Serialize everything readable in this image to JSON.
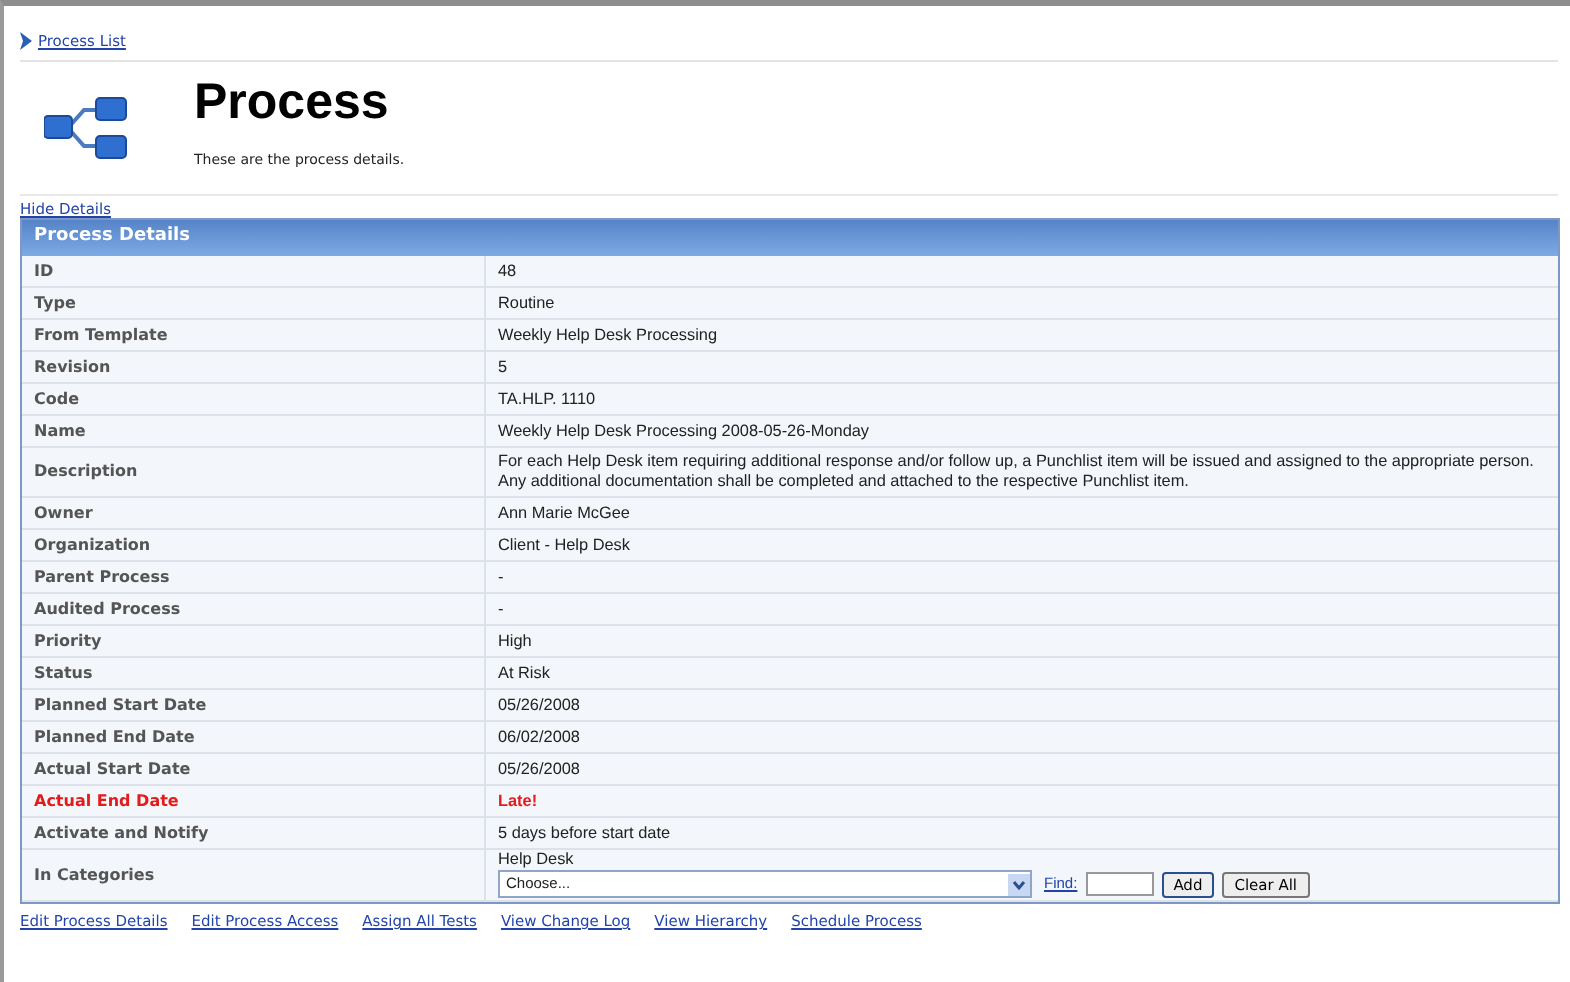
{
  "breadcrumb": {
    "link": "Process List"
  },
  "header": {
    "title": "Process",
    "subtitle": "These are the process details."
  },
  "toggle_link": "Hide Details",
  "panel": {
    "title": "Process Details",
    "rows": [
      {
        "kind": "text",
        "label": "ID",
        "value": "48",
        "alert": false
      },
      {
        "kind": "text",
        "label": "Type",
        "value": "Routine",
        "alert": false
      },
      {
        "kind": "text",
        "label": "From Template",
        "value": "Weekly Help Desk Processing",
        "alert": false
      },
      {
        "kind": "text",
        "label": "Revision",
        "value": "5",
        "alert": false
      },
      {
        "kind": "text",
        "label": "Code",
        "value": "TA.HLP. 1110",
        "alert": false
      },
      {
        "kind": "text",
        "label": "Name",
        "value": "Weekly Help Desk Processing 2008-05-26-Monday",
        "alert": false
      },
      {
        "kind": "text",
        "label": "Description",
        "value": "For each Help Desk item requiring additional response and/or follow up, a Punchlist item will be issued and assigned to the appropriate person.\n Any additional documentation shall be completed and attached to the respective Punchlist item.",
        "alert": false
      },
      {
        "kind": "text",
        "label": "Owner",
        "value": "Ann Marie McGee",
        "alert": false
      },
      {
        "kind": "text",
        "label": "Organization",
        "value": "Client - Help Desk",
        "alert": false
      },
      {
        "kind": "text",
        "label": "Parent Process",
        "value": "-",
        "alert": false
      },
      {
        "kind": "text",
        "label": "Audited Process",
        "value": "-",
        "alert": false
      },
      {
        "kind": "text",
        "label": "Priority",
        "value": "High",
        "alert": false
      },
      {
        "kind": "text",
        "label": "Status",
        "value": "At Risk",
        "alert": false
      },
      {
        "kind": "text",
        "label": "Planned Start Date",
        "value": "05/26/2008",
        "alert": false
      },
      {
        "kind": "text",
        "label": "Planned End Date",
        "value": "06/02/2008",
        "alert": false
      },
      {
        "kind": "text",
        "label": "Actual Start Date",
        "value": "05/26/2008",
        "alert": false
      },
      {
        "kind": "text",
        "label": "Actual End Date",
        "value": "Late!",
        "alert": true
      },
      {
        "kind": "text",
        "label": "Activate and Notify",
        "value": "5  days before start date",
        "alert": false
      },
      {
        "kind": "categories",
        "label": "In Categories",
        "category": "Help Desk",
        "select": {
          "value": "Choose..."
        },
        "find_link": "Find:",
        "buttons": [
          "Add",
          "Clear All"
        ]
      }
    ]
  },
  "actions": [
    "Edit Process Details",
    "Edit Process Access",
    "Assign All Tests",
    "View Change Log",
    "View Hierarchy",
    "Schedule Process"
  ]
}
